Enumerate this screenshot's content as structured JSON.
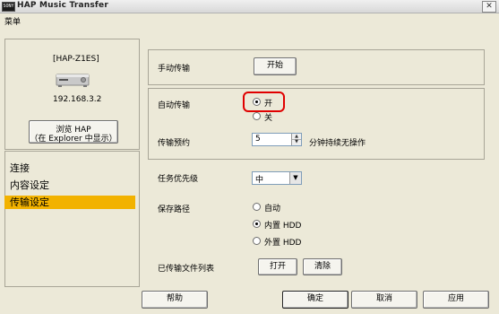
{
  "window": {
    "title": "HAP Music Transfer",
    "icon_text": "SONY",
    "close_glyph": "✕"
  },
  "menu": {
    "label": "菜单"
  },
  "device": {
    "name": "[HAP-Z1ES]",
    "ip": "192.168.3.2",
    "browse_line1": "浏览 HAP",
    "browse_line2": "（在 Explorer 中显示）"
  },
  "nav": {
    "items": [
      {
        "label": "连接"
      },
      {
        "label": "内容设定"
      },
      {
        "label": "传输设定"
      }
    ],
    "selected": "传输设定"
  },
  "manual": {
    "label": "手动传输",
    "button": "开始"
  },
  "auto": {
    "label": "自动传输",
    "on": "开",
    "off": "关",
    "selected": "开"
  },
  "schedule": {
    "label": "传输预约",
    "value": "5",
    "unit": "分钟持续无操作"
  },
  "priority": {
    "label": "任务优先级",
    "value": "中"
  },
  "save_path": {
    "label": "保存路径",
    "options": [
      "自动",
      "内置 HDD",
      "外置 HDD"
    ],
    "selected": "内置 HDD"
  },
  "transferred_list": {
    "label": "已传输文件列表",
    "open": "打开",
    "clear": "清除"
  },
  "footer": {
    "help": "帮助",
    "ok": "确定",
    "cancel": "取消",
    "apply": "应用"
  }
}
